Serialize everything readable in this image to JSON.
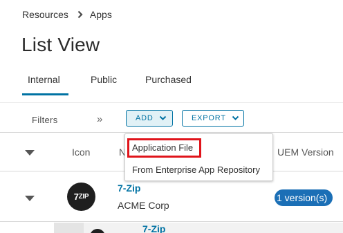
{
  "breadcrumb": {
    "items": [
      "Resources",
      "Apps"
    ]
  },
  "page": {
    "title": "List View"
  },
  "tabs": [
    {
      "label": "Internal",
      "active": true
    },
    {
      "label": "Public",
      "active": false
    },
    {
      "label": "Purchased",
      "active": false
    }
  ],
  "toolbar": {
    "filters_label": "Filters",
    "expand_glyph": "»",
    "add_label": "ADD",
    "export_label": "EXPORT"
  },
  "table": {
    "headers": {
      "icon": "Icon",
      "name": "N",
      "uem_version": "UEM Version"
    },
    "rows": [
      {
        "icon_text": "7",
        "icon_text_small": "ZIP",
        "name": "7-Zip",
        "org": "ACME Corp",
        "versions": "1 version(s)"
      }
    ],
    "subrow": {
      "name": "7-Zip"
    }
  },
  "add_menu": {
    "items": [
      "Application File",
      "From Enterprise App Repository"
    ],
    "highlighted_index": 0
  },
  "colors": {
    "accent": "#0072a3",
    "highlight": "#e0141b",
    "pill": "#1b6fb6"
  }
}
